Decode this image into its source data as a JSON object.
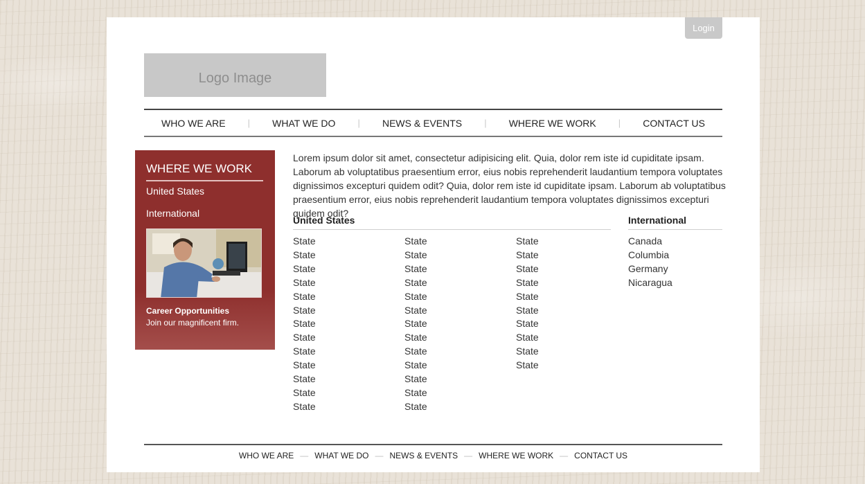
{
  "header": {
    "login_label": "Login",
    "logo_text": "Logo Image"
  },
  "nav": {
    "items": [
      "WHO WE ARE",
      "WHAT WE DO",
      "NEWS & EVENTS",
      "WHERE WE WORK",
      "CONTACT US"
    ],
    "separator": "|"
  },
  "sidebar": {
    "title": "WHERE WE WORK",
    "links": [
      "United States",
      "International"
    ],
    "career_title": "Career Opportunities",
    "career_subtitle": "Join our magnificent firm."
  },
  "main": {
    "intro": "Lorem ipsum dolor sit amet, consectetur adipisicing elit. Quia, dolor rem iste id cupiditate ipsam. Laborum ab voluptatibus praesentium error, eius nobis reprehenderit laudantium tempora voluptates dignissimos excepturi quidem odit? Quia, dolor rem iste id cupiditate ipsam. Laborum ab voluptatibus praesentium error, eius nobis reprehenderit laudantium tempora voluptates dignissimos excepturi quidem odit?",
    "us_heading": "United States",
    "intl_heading": "International",
    "us_columns": [
      [
        "State",
        "State",
        "State",
        "State",
        "State",
        "State",
        "State",
        "State",
        "State",
        "State",
        "State",
        "State",
        "State"
      ],
      [
        "State",
        "State",
        "State",
        "State",
        "State",
        "State",
        "State",
        "State",
        "State",
        "State",
        "State",
        "State",
        "State"
      ],
      [
        "State",
        "State",
        "State",
        "State",
        "State",
        "State",
        "State",
        "State",
        "State",
        "State"
      ]
    ],
    "intl_list": [
      "Canada",
      "Columbia",
      "Germany",
      "Nicaragua"
    ]
  },
  "footer": {
    "items": [
      "WHO WE ARE",
      "WHAT WE DO",
      "NEWS & EVENTS",
      "WHERE WE WORK",
      "CONTACT US"
    ],
    "separator": "—"
  },
  "colors": {
    "sidebar_red": "#8e2f2d",
    "login_gray": "#c9c9c9",
    "logo_gray": "#c8c8c8"
  }
}
